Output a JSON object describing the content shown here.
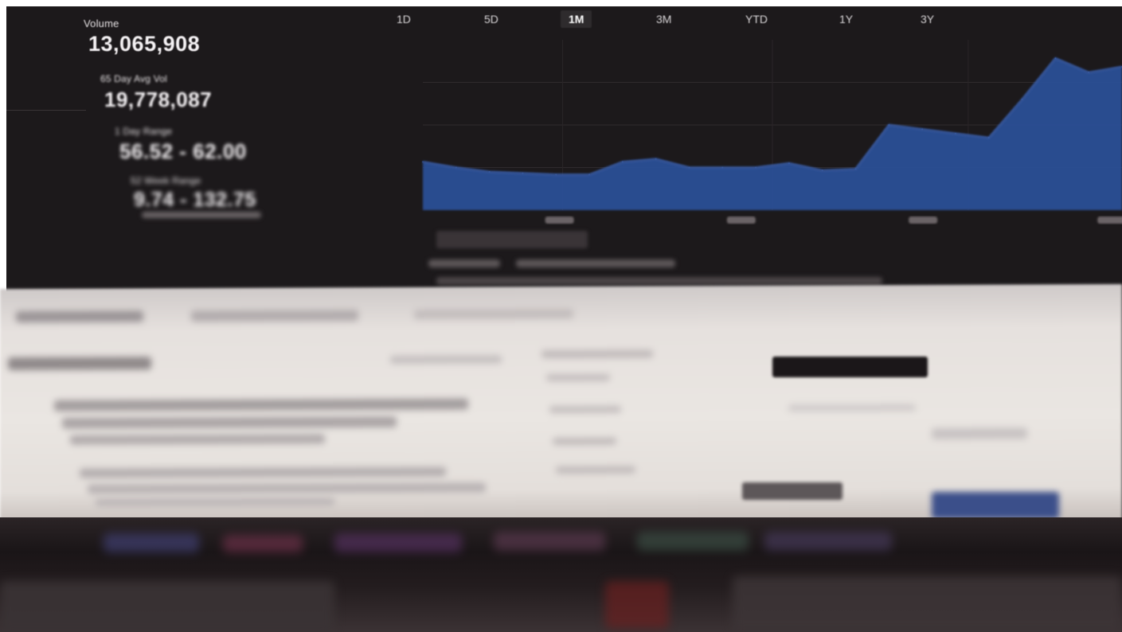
{
  "stats": {
    "volume_label": "Volume",
    "volume_value": "13,065,908",
    "avg_vol_label": "65 Day Avg Vol",
    "avg_vol_value": "19,778,087",
    "day_range_label": "1 Day Range",
    "day_range_value": "56.52 - 62.00",
    "week_range_label": "52 Week Range",
    "week_range_value": "9.74 - 132.75"
  },
  "tabs": [
    {
      "label": "1D",
      "active": false
    },
    {
      "label": "5D",
      "active": false
    },
    {
      "label": "1M",
      "active": true
    },
    {
      "label": "3M",
      "active": false
    },
    {
      "label": "YTD",
      "active": false
    },
    {
      "label": "1Y",
      "active": false
    },
    {
      "label": "3Y",
      "active": false
    }
  ],
  "chart_data": {
    "type": "area",
    "title": "",
    "xlabel": "",
    "ylabel": "",
    "x": [
      0,
      1,
      2,
      3,
      4,
      5,
      6,
      7,
      8,
      9,
      10,
      11,
      12,
      13,
      14,
      15,
      16,
      17,
      18,
      19,
      20,
      21
    ],
    "values": [
      34,
      30,
      27,
      26,
      25,
      25,
      34,
      36,
      30,
      30,
      30,
      33,
      28,
      29,
      60,
      57,
      54,
      51,
      78,
      107,
      97,
      101
    ],
    "ylim": [
      0,
      120
    ],
    "fill_color": "#2c4f96",
    "line_color": "#3c64b4",
    "grid": true
  },
  "colors": {
    "monitor_bg": "#1c191b",
    "accent_blue": "#2c4f96"
  }
}
